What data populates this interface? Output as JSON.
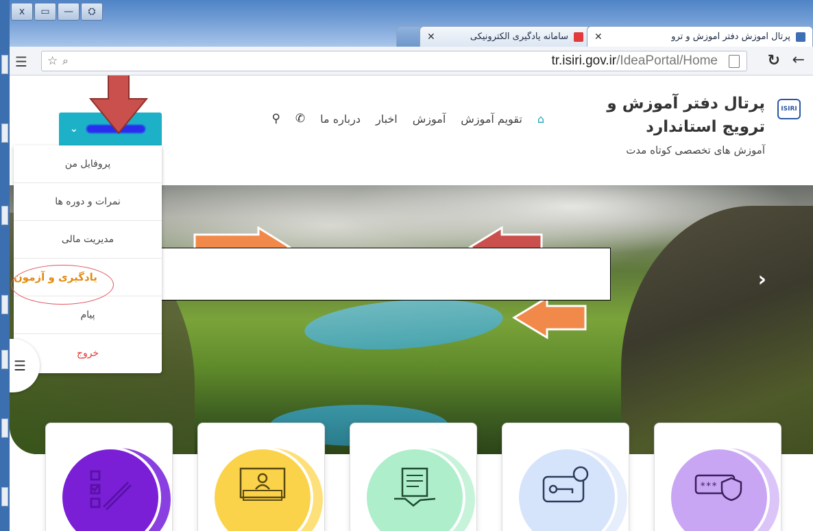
{
  "window": {
    "controls": [
      "x",
      "▭",
      "—",
      "⛭"
    ]
  },
  "tabs": [
    {
      "label": "پرتال آموزش دفتر آموزش و ترو",
      "active": true
    },
    {
      "label": "سامانه یادگیری الکترونیکی",
      "active": false
    },
    {
      "label": "",
      "active": false
    }
  ],
  "addressbar": {
    "url_main": "tr.isiri.gov.ir",
    "url_path": "/IdeaPortal/Home"
  },
  "brand": {
    "title": "پرتال دفتر آموزش و ترویج استاندارد",
    "subtitle": "آموزش های تخصصی کوتاه مدت",
    "logo_text": "ISIRI"
  },
  "nav": {
    "items": [
      "تقویم آموزش",
      "آموزش",
      "اخبار",
      "درباره ما"
    ]
  },
  "user_menu": {
    "items": [
      {
        "label": "پروفایل من"
      },
      {
        "label": "نمرات و دوره ها"
      },
      {
        "label": "مدیریت مالی"
      },
      {
        "label": "یادگیری و آزمون"
      },
      {
        "label": "پیام"
      },
      {
        "label": "خروج"
      }
    ]
  },
  "colors": {
    "accent": "#1db1c8",
    "highlight": "#e28a10",
    "logout": "#e2342f",
    "card_purple": "#7a1fd6",
    "card_yellow": "#fbd34a",
    "card_green": "#aeeecb",
    "card_blue": "#d6e4fb",
    "card_lilac": "#c9a6f4"
  },
  "cards": [
    {
      "icon": "checklist-pen-icon"
    },
    {
      "icon": "online-class-icon"
    },
    {
      "icon": "contract-handshake-icon"
    },
    {
      "icon": "key-lock-icon"
    },
    {
      "icon": "password-shield-icon"
    }
  ]
}
